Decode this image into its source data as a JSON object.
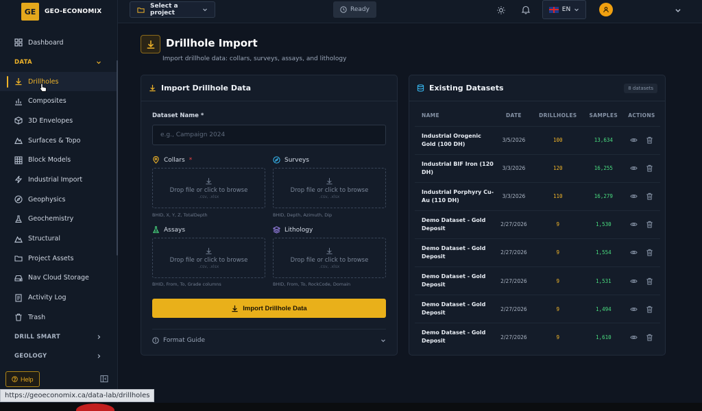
{
  "brand": {
    "logo": "GE",
    "name": "GEO-ECONOMIX"
  },
  "sidebar": {
    "top_items": [
      {
        "label": "Dashboard",
        "icon": "grid-icon"
      }
    ],
    "data_group": {
      "label": "DATA",
      "expanded": true
    },
    "data_items": [
      {
        "label": "Drillholes",
        "icon": "download-icon",
        "active": true
      },
      {
        "label": "Composites",
        "icon": "bar-chart-icon"
      },
      {
        "label": "3D Envelopes",
        "icon": "cube-icon"
      },
      {
        "label": "Surfaces & Topo",
        "icon": "mountain-icon"
      },
      {
        "label": "Block Models",
        "icon": "grid-icon"
      },
      {
        "label": "Industrial Import",
        "icon": "zap-icon"
      },
      {
        "label": "Geophysics",
        "icon": "compass-icon"
      },
      {
        "label": "Geochemistry",
        "icon": "flask-icon"
      },
      {
        "label": "Structural",
        "icon": "mountain-icon"
      },
      {
        "label": "Project Assets",
        "icon": "folder-icon"
      },
      {
        "label": "Nav Cloud Storage",
        "icon": "hard-drive-icon"
      },
      {
        "label": "Activity Log",
        "icon": "log-icon"
      },
      {
        "label": "Trash",
        "icon": "trash-icon"
      }
    ],
    "groups": [
      {
        "label": "DRILL SMART"
      },
      {
        "label": "GEOLOGY"
      }
    ],
    "help_label": "Help"
  },
  "topbar": {
    "project_select": "Select a project",
    "status": "Ready",
    "language": "EN"
  },
  "page": {
    "title": "Drillhole Import",
    "subtitle": "Import drillhole data: collars, surveys, assays, and lithology"
  },
  "import_card": {
    "title": "Import Drillhole Data",
    "dataset_label": "Dataset Name",
    "required_mark": "*",
    "dataset_placeholder": "e.g., Campaign 2024",
    "dropzone_text": "Drop file or click to browse",
    "dropzone_types": ".csv, .xlsx",
    "uploads": [
      {
        "label": "Collars",
        "required": true,
        "hint": "BHID, X, Y, Z, TotalDepth",
        "icon": "map-pin-icon",
        "color": "#f0b429"
      },
      {
        "label": "Surveys",
        "required": false,
        "hint": "BHID, Depth, Azimuth, Dip",
        "icon": "compass-icon",
        "color": "#38bdf8"
      },
      {
        "label": "Assays",
        "required": false,
        "hint": "BHID, From, To, Grade columns",
        "icon": "flask-icon",
        "color": "#4ade80"
      },
      {
        "label": "Lithology",
        "required": false,
        "hint": "BHID, From, To, RockCode, Domain",
        "icon": "layers-icon",
        "color": "#a78bfa"
      }
    ],
    "import_button": "Import Drillhole Data",
    "format_guide": "Format Guide"
  },
  "datasets_card": {
    "title": "Existing Datasets",
    "count_badge": "8 datasets",
    "columns": [
      "NAME",
      "DATE",
      "DRILLHOLES",
      "SAMPLES",
      "ACTIONS"
    ],
    "rows": [
      {
        "name": "Industrial Orogenic Gold (100 DH)",
        "date": "3/5/2026",
        "drillholes": "100",
        "samples": "13,634"
      },
      {
        "name": "Industrial BIF Iron (120 DH)",
        "date": "3/3/2026",
        "drillholes": "120",
        "samples": "16,255"
      },
      {
        "name": "Industrial Porphyry Cu-Au (110 DH)",
        "date": "3/3/2026",
        "drillholes": "110",
        "samples": "16,279"
      },
      {
        "name": "Demo Dataset - Gold Deposit",
        "date": "2/27/2026",
        "drillholes": "9",
        "samples": "1,530"
      },
      {
        "name": "Demo Dataset - Gold Deposit",
        "date": "2/27/2026",
        "drillholes": "9",
        "samples": "1,554"
      },
      {
        "name": "Demo Dataset - Gold Deposit",
        "date": "2/27/2026",
        "drillholes": "9",
        "samples": "1,531"
      },
      {
        "name": "Demo Dataset - Gold Deposit",
        "date": "2/27/2026",
        "drillholes": "9",
        "samples": "1,494"
      },
      {
        "name": "Demo Dataset - Gold Deposit",
        "date": "2/27/2026",
        "drillholes": "9",
        "samples": "1,610"
      }
    ]
  },
  "status_url": "https://geoeconomix.ca/data-lab/drillholes",
  "colors": {
    "accent": "#f0b429",
    "samples_green": "#4ade80",
    "danger": "#ef4444"
  }
}
